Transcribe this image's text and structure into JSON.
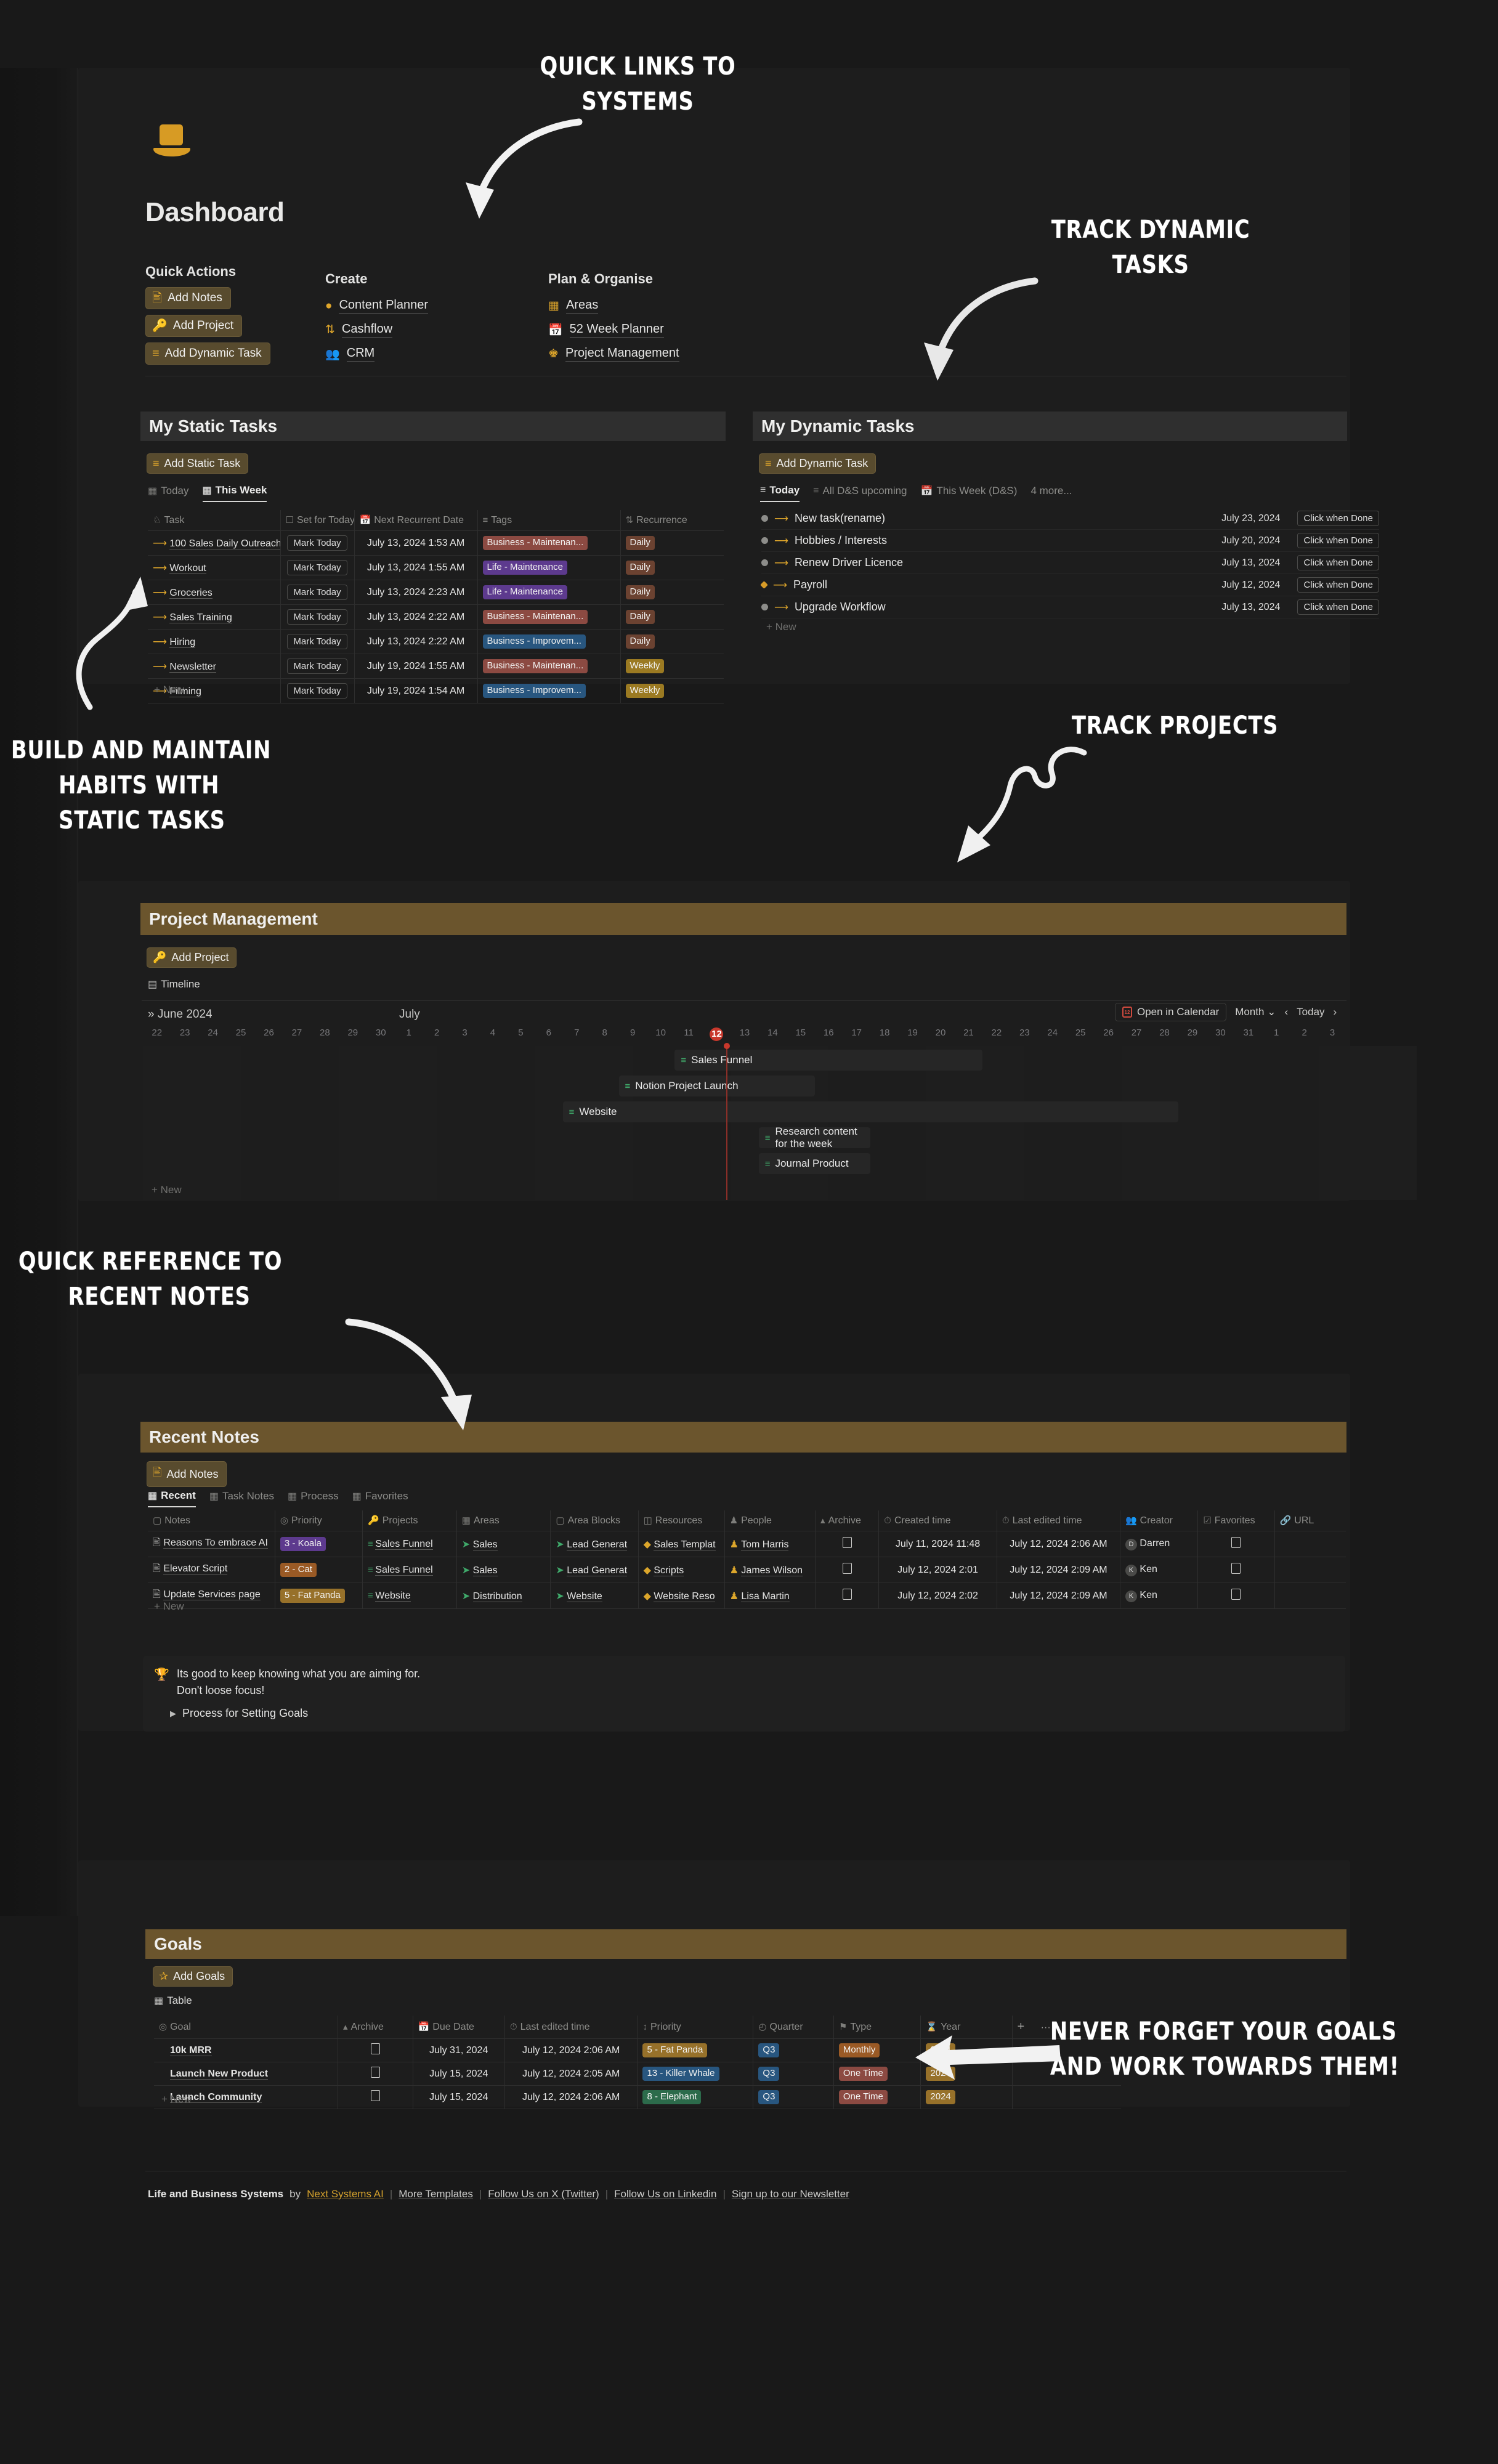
{
  "page": {
    "title": "Dashboard",
    "icon": "tophat-icon"
  },
  "quick_actions": {
    "heading": "Quick Actions",
    "buttons": [
      {
        "label": "Add Notes",
        "icon": "note-add-icon"
      },
      {
        "label": "Add Project",
        "icon": "key-icon"
      },
      {
        "label": "Add Dynamic Task",
        "icon": "list-icon"
      }
    ]
  },
  "create": {
    "heading": "Create",
    "links": [
      {
        "label": "Content Planner",
        "icon": "content-planner-icon"
      },
      {
        "label": "Cashflow",
        "icon": "cashflow-icon"
      },
      {
        "label": "CRM",
        "icon": "people-icon"
      }
    ]
  },
  "plan_organise": {
    "heading": "Plan & Organise",
    "links": [
      {
        "label": "Areas",
        "icon": "grid-icon"
      },
      {
        "label": "52 Week Planner",
        "icon": "calendar-icon"
      },
      {
        "label": "Project Management",
        "icon": "project-icon"
      }
    ]
  },
  "static_tasks": {
    "heading": "My Static Tasks",
    "add_label": "Add Static Task",
    "tabs": [
      {
        "label": "Today",
        "active": false
      },
      {
        "label": "This Week",
        "active": true
      }
    ],
    "columns": [
      "Task",
      "Set for Today",
      "Next Recurrent Date",
      "Tags",
      "Recurrence"
    ],
    "rows": [
      {
        "task": "100 Sales Daily Outreach",
        "set_for_today": "Mark Today",
        "next": "July 13, 2024 1:53 AM",
        "tag": "Business - Maintenan...",
        "tag_color": "#8c4a42",
        "rec": "Daily",
        "rec_color": "#6b4231"
      },
      {
        "task": "Workout",
        "set_for_today": "Mark Today",
        "next": "July 13, 2024 1:55 AM",
        "tag": "Life - Maintenance",
        "tag_color": "#5d3a8e",
        "rec": "Daily",
        "rec_color": "#6b4231"
      },
      {
        "task": "Groceries",
        "set_for_today": "Mark Today",
        "next": "July 13, 2024 2:23 AM",
        "tag": "Life - Maintenance",
        "tag_color": "#5d3a8e",
        "rec": "Daily",
        "rec_color": "#6b4231"
      },
      {
        "task": "Sales Training",
        "set_for_today": "Mark Today",
        "next": "July 13, 2024 2:22 AM",
        "tag": "Business - Maintenan...",
        "tag_color": "#8c4a42",
        "rec": "Daily",
        "rec_color": "#6b4231"
      },
      {
        "task": "Hiring",
        "set_for_today": "Mark Today",
        "next": "July 13, 2024 2:22 AM",
        "tag": "Business - Improvem...",
        "tag_color": "#28567f",
        "rec": "Daily",
        "rec_color": "#6b4231"
      },
      {
        "task": "Newsletter",
        "set_for_today": "Mark Today",
        "next": "July 19, 2024 1:55 AM",
        "tag": "Business - Maintenan...",
        "tag_color": "#8c4a42",
        "rec": "Weekly",
        "rec_color": "#9b7a22"
      },
      {
        "task": "Filming",
        "set_for_today": "Mark Today",
        "next": "July 19, 2024 1:54 AM",
        "tag": "Business - Improvem...",
        "tag_color": "#28567f",
        "rec": "Weekly",
        "rec_color": "#9b7a22"
      }
    ],
    "new_label": "+ New"
  },
  "dynamic_tasks": {
    "heading": "My Dynamic Tasks",
    "add_label": "Add Dynamic Task",
    "tabs": [
      {
        "label": "Today",
        "active": true
      },
      {
        "label": "All D&S upcoming",
        "active": false
      },
      {
        "label": "This Week (D&S)",
        "active": false
      },
      {
        "label": "4 more...",
        "active": false
      }
    ],
    "rows": [
      {
        "name": "New task(rename)",
        "date": "July 23, 2024",
        "action": "Click when Done",
        "flag": "grey"
      },
      {
        "name": "Hobbies / Interests",
        "date": "July 20, 2024",
        "action": "Click when Done",
        "flag": "grey"
      },
      {
        "name": "Renew Driver Licence",
        "date": "July 13, 2024",
        "action": "Click when Done",
        "flag": "grey"
      },
      {
        "name": "Payroll",
        "date": "July 12, 2024",
        "action": "Click when Done",
        "flag": "amber"
      },
      {
        "name": "Upgrade Workflow",
        "date": "July 13, 2024",
        "action": "Click when Done",
        "flag": "grey"
      }
    ],
    "new_label": "+ New"
  },
  "project_management": {
    "heading": "Project Management",
    "add_label": "Add Project",
    "tabs": [
      {
        "label": "Timeline",
        "active": true
      }
    ],
    "toolbar": {
      "open_calendar": "Open in Calendar",
      "scale": "Month",
      "today": "Today",
      "prev": "‹",
      "next": "›"
    },
    "months": [
      {
        "label": "June 2024"
      },
      {
        "label": "July"
      }
    ],
    "days": [
      "22",
      "23",
      "24",
      "25",
      "26",
      "27",
      "28",
      "29",
      "30",
      "1",
      "2",
      "3",
      "4",
      "5",
      "6",
      "7",
      "8",
      "9",
      "10",
      "11",
      "12",
      "13",
      "14",
      "15",
      "16",
      "17",
      "18",
      "19",
      "20",
      "21",
      "22",
      "23",
      "24",
      "25",
      "26",
      "27",
      "28",
      "29",
      "30",
      "31",
      "1",
      "2",
      "3"
    ],
    "today_index": 20,
    "bars": [
      {
        "label": "Sales Funnel",
        "start": 19,
        "end": 30
      },
      {
        "label": "Notion Project Launch",
        "start": 17,
        "end": 24
      },
      {
        "label": "Website",
        "start": 15,
        "end": 37
      },
      {
        "label": "Research content for the week",
        "start": 22,
        "end": 26
      },
      {
        "label": "Journal Product",
        "start": 22,
        "end": 26
      }
    ],
    "new_label": "+ New"
  },
  "recent_notes": {
    "heading": "Recent Notes",
    "add_label": "Add Notes",
    "tabs": [
      {
        "label": "Recent",
        "active": true
      },
      {
        "label": "Task Notes",
        "active": false
      },
      {
        "label": "Process",
        "active": false
      },
      {
        "label": "Favorites",
        "active": false
      }
    ],
    "columns": [
      "Notes",
      "Priority",
      "Projects",
      "Areas",
      "Area Blocks",
      "Resources",
      "People",
      "Archive",
      "Created time",
      "Last edited time",
      "Creator",
      "Favorites",
      "URL"
    ],
    "rows": [
      {
        "note": "Reasons To embrace AI",
        "priority": "3 - Koala",
        "priority_color": "#5d3a8e",
        "project": "Sales Funnel",
        "area": "Sales",
        "area_block": "Lead Generat",
        "resource": "Sales Templat",
        "person": "Tom Harris",
        "created": "July 11, 2024 11:48",
        "edited": "July 12, 2024 2:06 AM",
        "creator": "Darren",
        "creator_initial": "D"
      },
      {
        "note": "Elevator Script",
        "priority": "2 - Cat",
        "priority_color": "#9a5a25",
        "project": "Sales Funnel",
        "area": "Sales",
        "area_block": "Lead Generat",
        "resource": "Scripts",
        "person": "James Wilson",
        "created": "July 12, 2024 2:01",
        "edited": "July 12, 2024 2:09 AM",
        "creator": "Ken",
        "creator_initial": "K"
      },
      {
        "note": "Update Services page",
        "priority": "5 - Fat Panda",
        "priority_color": "#97712a",
        "project": "Website",
        "area": "Distribution",
        "area_block": "Website",
        "resource": "Website Reso",
        "person": "Lisa Martin",
        "created": "July 12, 2024 2:02",
        "edited": "July 12, 2024 2:09 AM",
        "creator": "Ken",
        "creator_initial": "K"
      }
    ],
    "new_label": "+ New"
  },
  "callout": {
    "icon": "trophy-icon",
    "line1": "Its good to keep knowing what you are aiming for.",
    "line2": "Don't loose focus!",
    "toggle": "Process for Setting Goals"
  },
  "goals": {
    "heading": "Goals",
    "add_label": "Add Goals",
    "tabs": [
      {
        "label": "Table",
        "active": true
      }
    ],
    "columns": [
      "Goal",
      "Archive",
      "Due Date",
      "Last edited time",
      "Priority",
      "Quarter",
      "Type",
      "Year"
    ],
    "add_column": "+",
    "more": "···",
    "rows": [
      {
        "goal": "10k MRR",
        "due": "July 31, 2024",
        "edited": "July 12, 2024 2:06 AM",
        "priority": "5 - Fat Panda",
        "priority_color": "#97712a",
        "quarter": "Q3",
        "quarter_color": "#28567f",
        "type": "Monthly",
        "type_color": "#9a5a25",
        "year": "2024",
        "year_color": "#97712a"
      },
      {
        "goal": "Launch New Product",
        "due": "July 15, 2024",
        "edited": "July 12, 2024 2:05 AM",
        "priority": "13 - Killer Whale",
        "priority_color": "#28567f",
        "quarter": "Q3",
        "quarter_color": "#28567f",
        "type": "One Time",
        "type_color": "#8c4a42",
        "year": "2024",
        "year_color": "#97712a"
      },
      {
        "goal": "Launch Community",
        "due": "July 15, 2024",
        "edited": "July 12, 2024 2:06 AM",
        "priority": "8 - Elephant",
        "priority_color": "#2c6b4b",
        "quarter": "Q3",
        "quarter_color": "#28567f",
        "type": "One Time",
        "type_color": "#8c4a42",
        "year": "2024",
        "year_color": "#97712a"
      }
    ],
    "new_label": "+ New"
  },
  "footer": {
    "title": "Life and Business Systems",
    "by": "by",
    "brand": "Next Systems AI",
    "links": [
      "More Templates",
      "Follow Us on X (Twitter)",
      "Follow Us on Linkedin",
      "Sign up to our Newsletter"
    ]
  },
  "annotations": [
    {
      "id": "a1",
      "line1": "QUICK LINKS TO",
      "line2": "SYSTEMS"
    },
    {
      "id": "a2",
      "line1": "TRACK DYNAMIC",
      "line2": "TASKS"
    },
    {
      "id": "a3",
      "line1": "BUILD AND MAINTAIN",
      "line2": "HABITS WITH",
      "line3": "STATIC TASKS"
    },
    {
      "id": "a4",
      "line1": "TRACK PROJECTS"
    },
    {
      "id": "a5",
      "line1": "QUICK  REFERENCE TO",
      "line2": "RECENT NOTES"
    },
    {
      "id": "a6",
      "line1": "NEVER FORGET YOUR GOALS",
      "line2": "AND WORK TOWARDS THEM!"
    }
  ],
  "colors": {
    "page_bg": "#191919",
    "panel_bg": "#1d1d1d",
    "accent": "#e0a72b",
    "brown_header": "#6b552d",
    "grey_header": "#2f2f2f"
  }
}
